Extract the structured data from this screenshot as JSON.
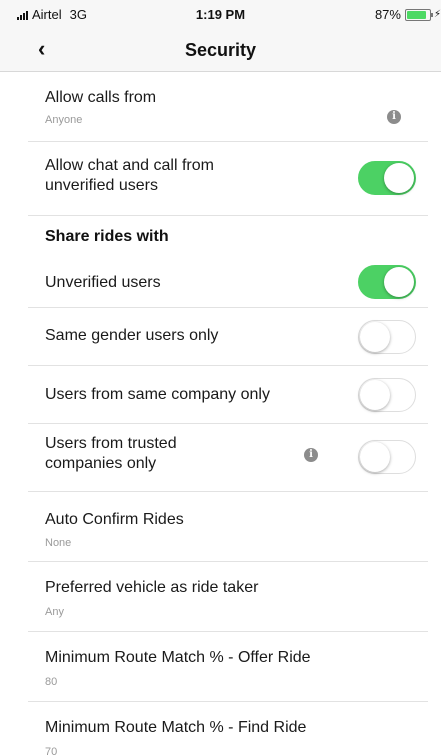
{
  "status_bar": {
    "carrier": "Airtel",
    "network": "3G",
    "time": "1:19 PM",
    "battery": "87%",
    "battery_level": 0.87
  },
  "nav": {
    "back": "‹",
    "title": "Security"
  },
  "rows": {
    "allow_calls": {
      "label": "Allow calls from",
      "value": "Anyone"
    },
    "allow_chat": {
      "label": "Allow chat and call from unverified users",
      "toggle": true
    },
    "share_header": {
      "label": "Share rides with"
    },
    "unverified": {
      "label": "Unverified users",
      "toggle": true
    },
    "same_gender": {
      "label": "Same gender users only",
      "toggle": false
    },
    "same_company": {
      "label": "Users from same company only",
      "toggle": false
    },
    "trusted": {
      "label": "Users from trusted companies only",
      "toggle": false
    },
    "auto_confirm": {
      "label": "Auto Confirm Rides",
      "value": "None"
    },
    "preferred_vehicle": {
      "label": "Preferred vehicle as ride taker",
      "value": "Any"
    },
    "route_offer": {
      "label": "Minimum Route Match % - Offer Ride",
      "value": "80"
    },
    "route_find": {
      "label": "Minimum Route Match % - Find Ride",
      "value": "70"
    }
  },
  "info_glyph": "i",
  "colors": {
    "toggle_on": "#4cd164",
    "battery": "#4cd964"
  }
}
